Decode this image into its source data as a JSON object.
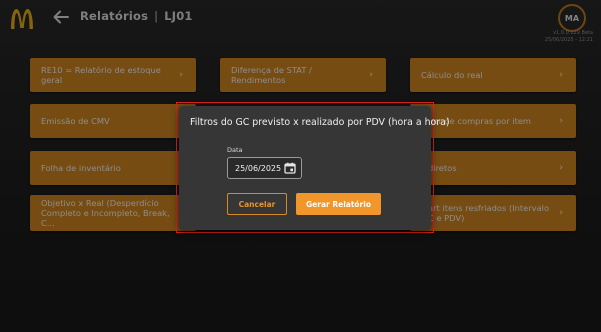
{
  "header": {
    "title": "Relatórios",
    "separator": "|",
    "store": "LJ01",
    "user_initials": "MA",
    "version": "v1.0.0.129 Beta",
    "datetime": "25/06/2025 - 12:21"
  },
  "icons": {
    "logo": "mcdonalds-logo",
    "back": "arrow-left-icon",
    "tile_chevron": "chevron-right-icon",
    "calendar": "calendar-icon"
  },
  "tiles": [
    {
      "label": "RE10 = Relatório de estoque geral",
      "chevron": "›"
    },
    {
      "label": "Diferença de STAT / Rendimentos",
      "chevron": "›"
    },
    {
      "label": "Cálculo do real",
      "chevron": "›"
    },
    {
      "label": "Emissão de CMV",
      "chevron": "›"
    },
    {
      "label": "ger de compras por item",
      "chevron": "›"
    },
    {
      "label": "Folha de inventário",
      "chevron": "›"
    },
    {
      "label": "diretos",
      "chevron": "›"
    },
    {
      "label": "Objetivo x Real (Desperdício Completo e Incompleto, Break, C...",
      "chevron": "›"
    },
    {
      "label": "art itens resfriados (Intervalo C e PDV)",
      "chevron": "›"
    }
  ],
  "modal": {
    "title": "Filtros do GC previsto x realizado por PDV (hora a hora)",
    "date_label": "Data",
    "date_value": "25/06/2025",
    "cancel_label": "Cancelar",
    "generate_label": "Gerar Relatório"
  },
  "colors": {
    "accent": "#d88a22",
    "button_primary": "#f0962a",
    "highlight_border": "#e02020",
    "modal_bg": "#363636"
  }
}
